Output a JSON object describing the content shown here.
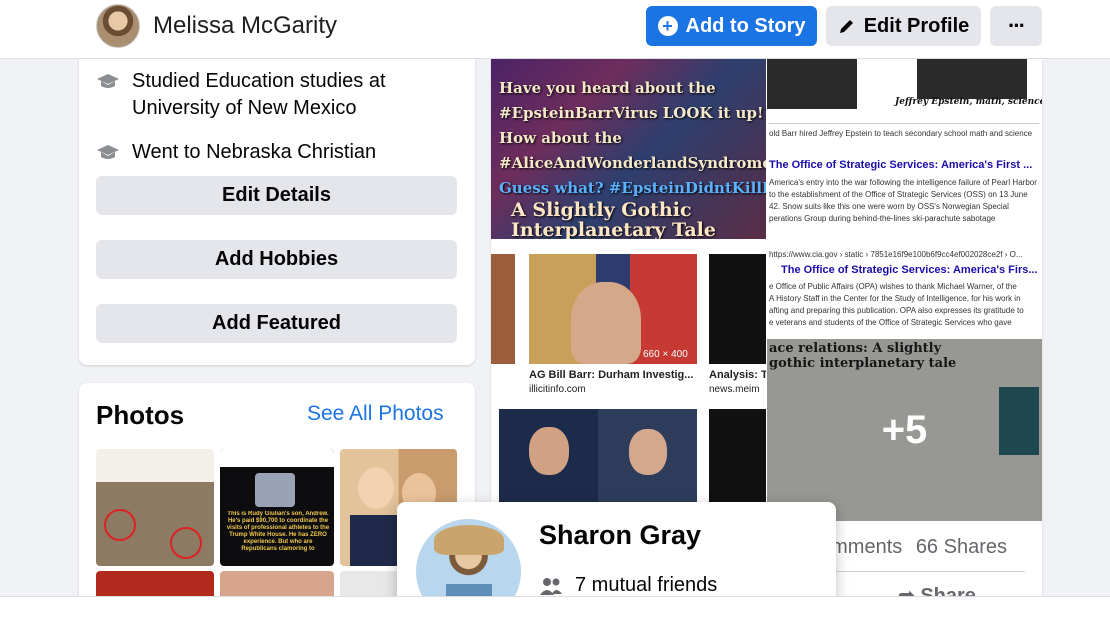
{
  "header": {
    "profile_name": "Melissa McGarity",
    "add_story_label": "Add to Story",
    "edit_profile_label": "Edit Profile",
    "more_label": "···"
  },
  "intro": {
    "education_line1": "Studied Education studies at",
    "education_line2": "University of New Mexico",
    "school": "Went to Nebraska Christian",
    "edit_details": "Edit Details",
    "add_hobbies": "Add Hobbies",
    "add_featured": "Add Featured"
  },
  "photos": {
    "title": "Photos",
    "see_all": "See All Photos",
    "thumb2_caption": "This is Rudy Giulian's son, Andrew. He's paid $90,700 to coordinate the visits of professional athletes to the Trump White House. He has ZERO experience. But who are Republicans clamoring to"
  },
  "post": {
    "meme_lines": [
      "Have you heard about the",
      "#EpsteinBarrVirus LOOK it up!",
      "How about the",
      "#AliceAndWonderlandSyndrome?",
      "Guess what? #EpsteinDidntKillHimsel",
      "A Slightly Gothic",
      "Interplanetary Tale"
    ],
    "news_caption": "Jeffrey Epstein, math, science",
    "oss_title_1": "The Office of Strategic Services: America's First ...",
    "oss_title_2": "The Office of Strategic Services: America's Firs...",
    "cia_url": "https://www.cia.gov › static › 7851e16f9e100b6f9cc4ef002028ce2f › O...",
    "barr_title": "AG Bill Barr: Durham Investig...",
    "barr_source": "illicitinfo.com",
    "barr_size": "660 × 400",
    "analysis_title": "Analysis: T",
    "analysis_source": "news.meim",
    "book_title": "ace relations: A slightly gothic interplanetary tale",
    "more_count": "+5",
    "comments": "omments",
    "shares": "66 Shares",
    "share_label": "Share"
  },
  "hover_card": {
    "name": "Sharon Gray",
    "mutual": "7 mutual friends"
  }
}
